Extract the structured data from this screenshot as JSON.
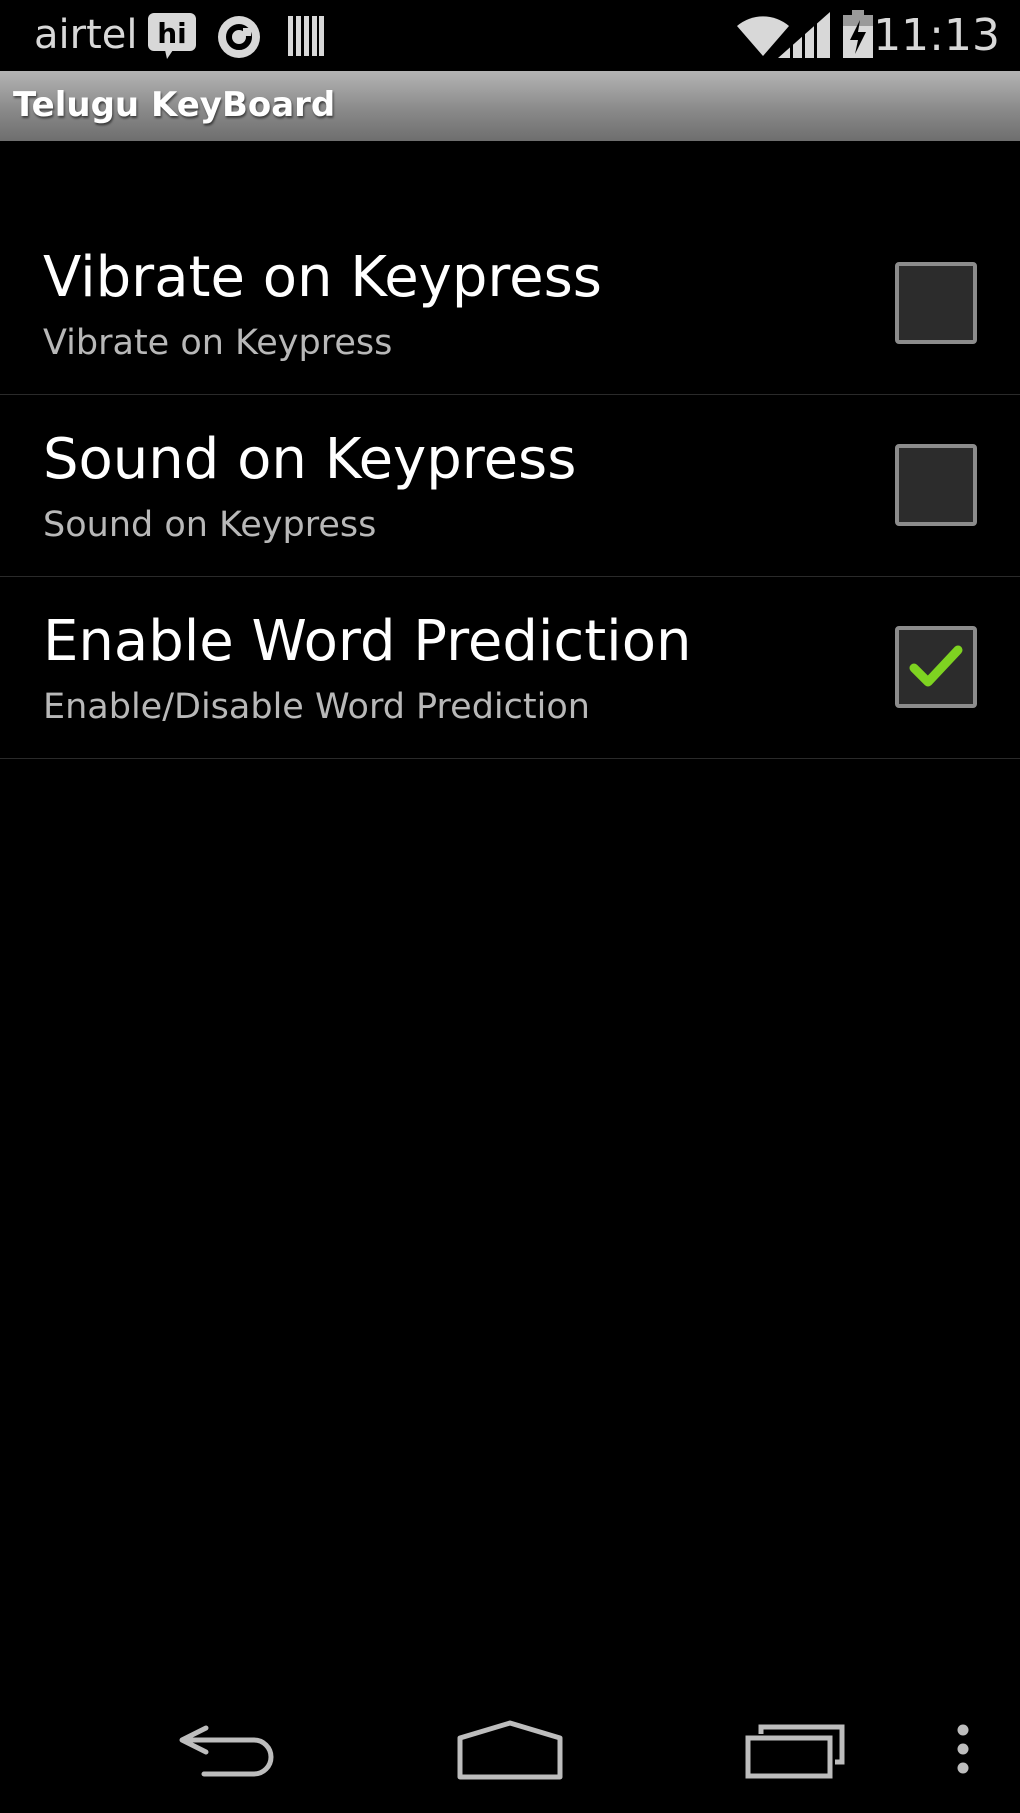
{
  "status_bar": {
    "carrier": "airtel",
    "hike_icon_text": "hi",
    "time": "11:13"
  },
  "app": {
    "title": "Telugu KeyBoard"
  },
  "preferences": [
    {
      "title": "Vibrate on Keypress",
      "summary": "Vibrate on Keypress",
      "checked": false
    },
    {
      "title": "Sound on Keypress",
      "summary": "Sound on Keypress",
      "checked": false
    },
    {
      "title": "Enable Word Prediction",
      "summary": "Enable/Disable Word Prediction",
      "checked": true
    }
  ],
  "colors": {
    "checkmark": "#7ed321",
    "background": "#000000"
  },
  "nav_bar": {
    "icons": [
      "back-icon",
      "home-icon",
      "recent-apps-icon",
      "overflow-menu-icon"
    ]
  }
}
